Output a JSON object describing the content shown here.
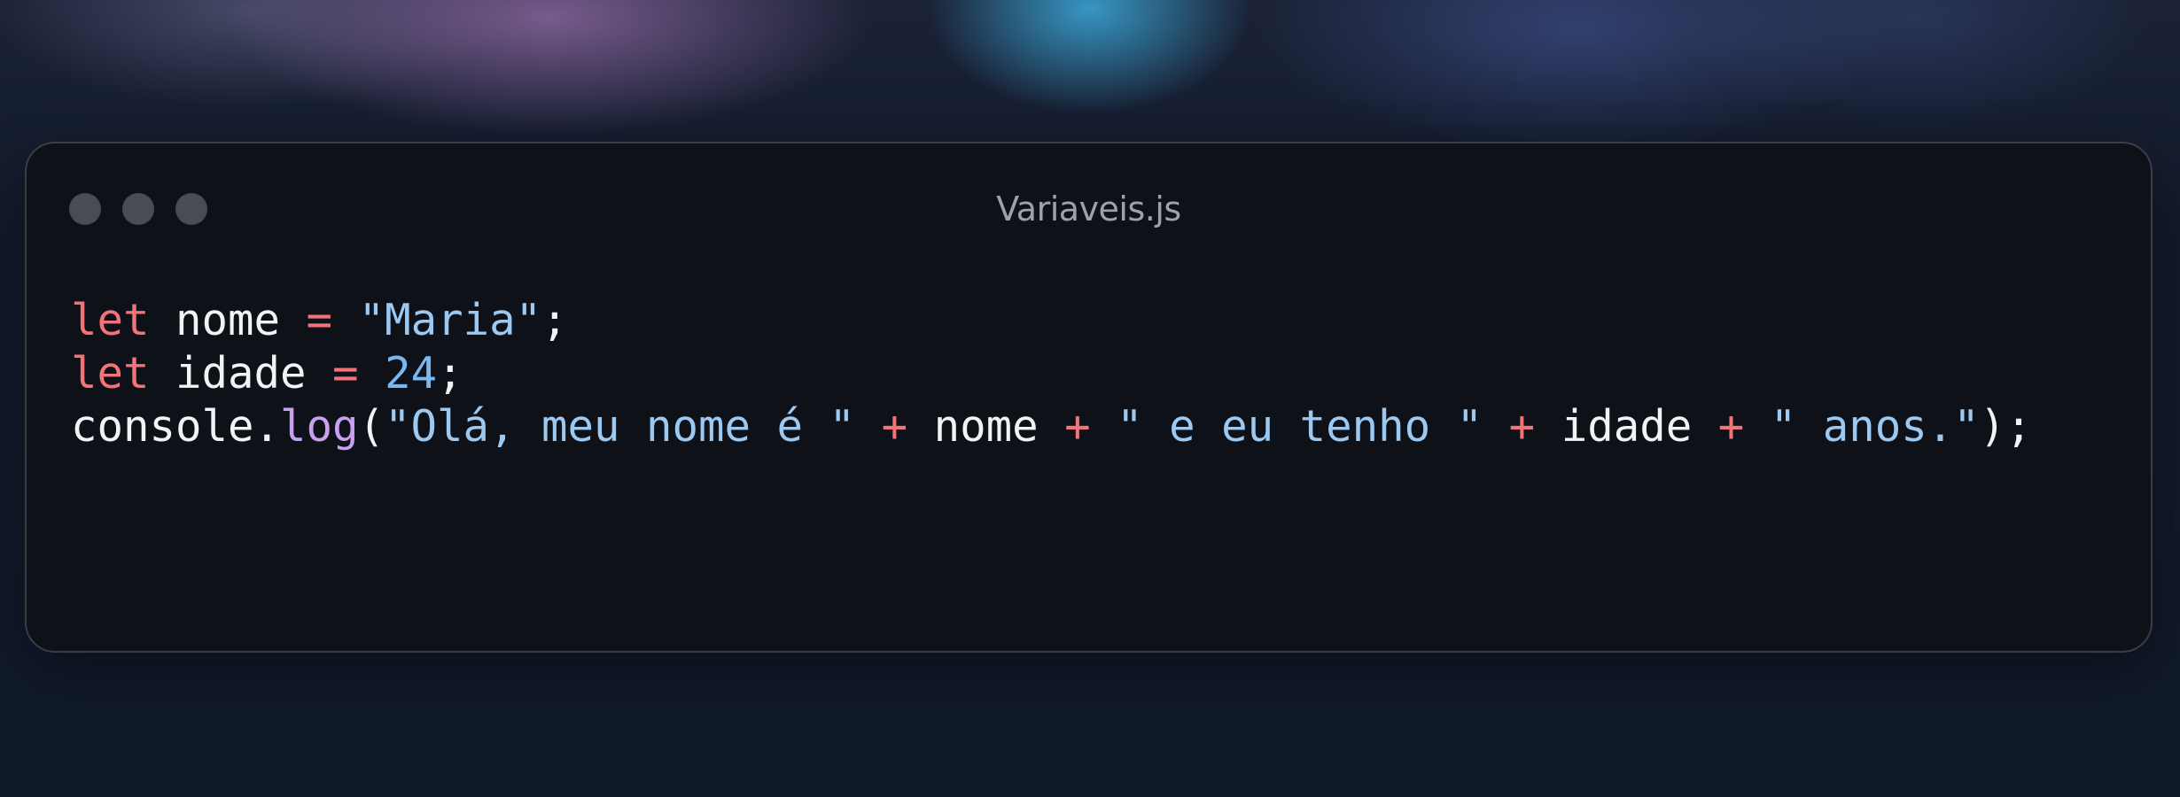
{
  "window": {
    "title": "Variaveis.js"
  },
  "colors": {
    "keyword": "#f2747a",
    "operator": "#f2747a",
    "string": "#9cc9f1",
    "number": "#79b8f0",
    "function": "#c9a0f0",
    "text": "#f2f3f5",
    "window_bg": "#0f1119"
  },
  "code": {
    "lines": [
      [
        {
          "t": "let",
          "c": "kw"
        },
        {
          "t": " nome ",
          "c": "id"
        },
        {
          "t": "=",
          "c": "op"
        },
        {
          "t": " ",
          "c": "id"
        },
        {
          "t": "\"Maria\"",
          "c": "str"
        },
        {
          "t": ";",
          "c": "id"
        }
      ],
      [
        {
          "t": "let",
          "c": "kw"
        },
        {
          "t": " idade ",
          "c": "id"
        },
        {
          "t": "=",
          "c": "op"
        },
        {
          "t": " ",
          "c": "id"
        },
        {
          "t": "24",
          "c": "num"
        },
        {
          "t": ";",
          "c": "id"
        }
      ],
      [
        {
          "t": "console.",
          "c": "id"
        },
        {
          "t": "log",
          "c": "fn"
        },
        {
          "t": "(",
          "c": "id"
        },
        {
          "t": "\"Olá, meu nome é \"",
          "c": "str"
        },
        {
          "t": " ",
          "c": "id"
        },
        {
          "t": "+",
          "c": "op"
        },
        {
          "t": " nome ",
          "c": "id"
        },
        {
          "t": "+",
          "c": "op"
        },
        {
          "t": " ",
          "c": "id"
        },
        {
          "t": "\" e eu tenho \"",
          "c": "str"
        },
        {
          "t": " ",
          "c": "id"
        },
        {
          "t": "+",
          "c": "op"
        },
        {
          "t": " idade ",
          "c": "id"
        },
        {
          "t": "+",
          "c": "op"
        },
        {
          "t": " ",
          "c": "id"
        },
        {
          "t": "\" anos.\"",
          "c": "str"
        },
        {
          "t": ");",
          "c": "id"
        }
      ]
    ]
  }
}
